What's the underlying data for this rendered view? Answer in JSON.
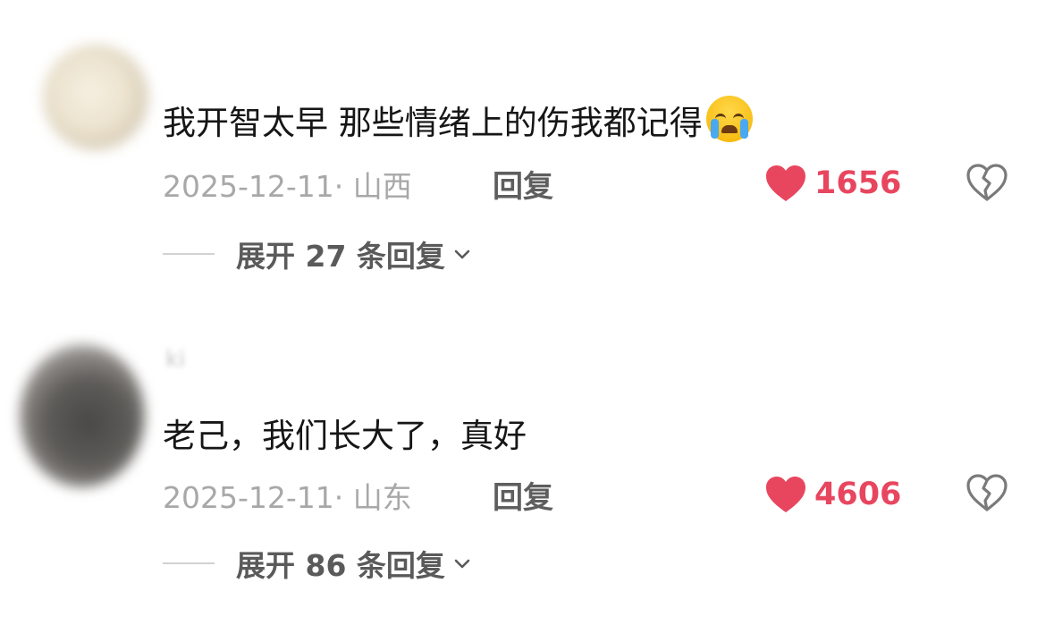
{
  "colors": {
    "like": "#e8465f",
    "meta": "#a8a8a8",
    "text": "#161616"
  },
  "comments": [
    {
      "username": "",
      "text": "我开智太早 那些情绪上的伤我都记得",
      "emoji": "loudly-crying-face",
      "date": "2025-12-11",
      "location": "· 山西",
      "reply_label": "回复",
      "likes": "1656",
      "expand_label": "展开 27 条回复"
    },
    {
      "username": "ki",
      "text": "老己，我们长大了，真好",
      "date": "2025-12-11",
      "location": "· 山东",
      "reply_label": "回复",
      "likes": "4606",
      "expand_label": "展开 86 条回复"
    }
  ]
}
